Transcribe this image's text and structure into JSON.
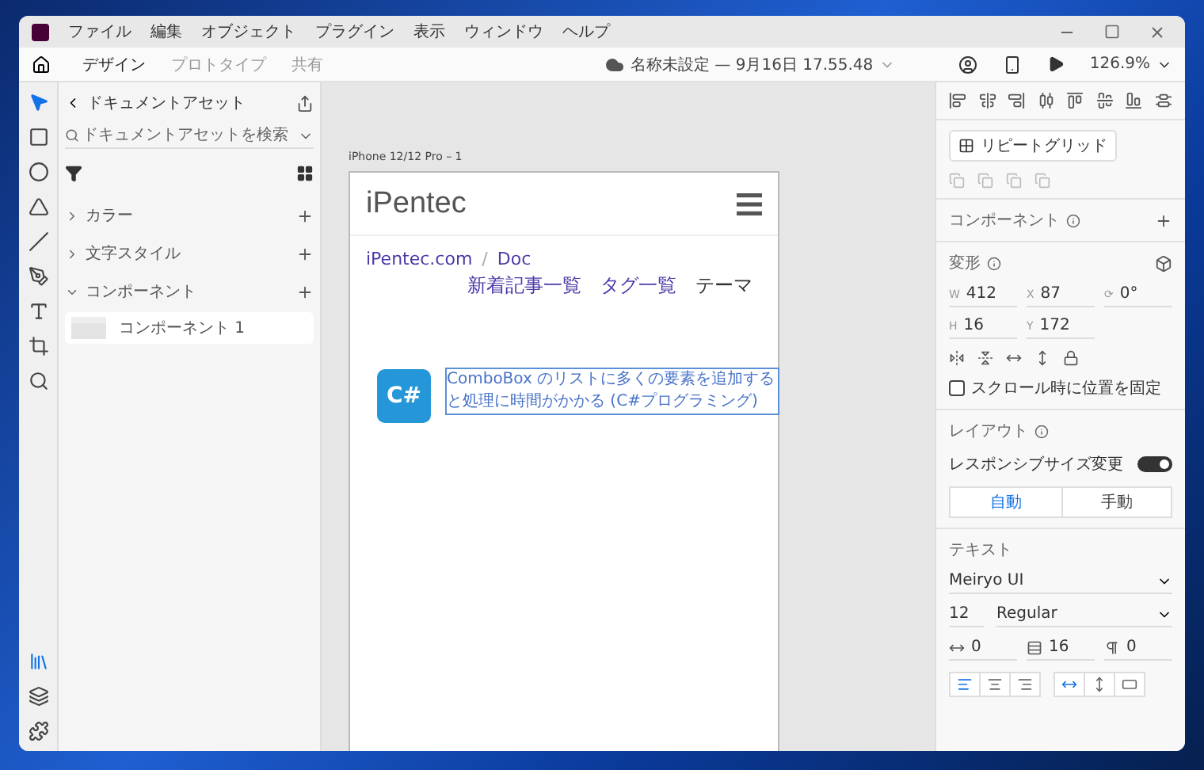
{
  "menu": [
    "ファイル",
    "編集",
    "オブジェクト",
    "プラグイン",
    "表示",
    "ウィンドウ",
    "ヘルプ"
  ],
  "tabs": [
    {
      "label": "デザイン",
      "selected": true
    },
    {
      "label": "プロトタイプ",
      "selected": false
    },
    {
      "label": "共有",
      "selected": false
    }
  ],
  "document_title": "名称未設定 — 9月16日 17.55.48",
  "zoom": "126.9%",
  "tools": [
    {
      "kind": "select",
      "selected": true
    },
    {
      "kind": "rectangle",
      "selected": false
    },
    {
      "kind": "ellipse",
      "selected": false
    },
    {
      "kind": "polygon",
      "selected": false
    },
    {
      "kind": "line",
      "selected": false
    },
    {
      "kind": "pen",
      "selected": false
    },
    {
      "kind": "text",
      "selected": false
    },
    {
      "kind": "artboard",
      "selected": false
    },
    {
      "kind": "zoom",
      "selected": false
    }
  ],
  "bottom_tools": [
    {
      "kind": "assets",
      "selected": true
    },
    {
      "kind": "layers",
      "selected": false
    },
    {
      "kind": "plugins",
      "selected": false
    }
  ],
  "assets": {
    "title": "ドキュメントアセット",
    "search": {
      "placeholder": "ドキュメントアセットを検索"
    },
    "sections": [
      {
        "label": "カラー",
        "expanded": false
      },
      {
        "label": "文字スタイル",
        "expanded": false
      },
      {
        "label": "コンポーネント",
        "expanded": true
      }
    ],
    "components": [
      {
        "label": "コンポーネント 1"
      }
    ]
  },
  "artboard": {
    "label": "iPhone 12/12 Pro – 1",
    "logo": "iPentec",
    "breadcrumb": [
      "iPentec.com",
      "Doc"
    ],
    "breadcrumb_separator": "/",
    "nav": [
      {
        "label": "新着記事一覧",
        "link": true
      },
      {
        "label": "タグ一覧",
        "link": true
      },
      {
        "label": "テーマ",
        "link": false
      }
    ],
    "badge": "C#",
    "article": {
      "title": "ComboBox のリストに多くの要素を追加すると処理に時間がかかる (C#プログラミング)",
      "selected": true
    }
  },
  "inspector": {
    "repeat_grid": "リピートグリッド",
    "component": "コンポーネント",
    "transform": "変形",
    "fields": [
      {
        "label": "W",
        "value": "412"
      },
      {
        "label": "X",
        "value": "87"
      },
      {
        "label": "⟳",
        "value": "0°"
      },
      {
        "label": "H",
        "value": "16"
      },
      {
        "label": "Y",
        "value": "172"
      }
    ],
    "fix_scroll": {
      "label": "スクロール時に位置を固定",
      "checked": false
    },
    "layout": "レイアウト",
    "responsive": {
      "label": "レスポンシブサイズ変更",
      "on": true
    },
    "resize_modes": [
      {
        "label": "自動",
        "selected": true
      },
      {
        "label": "手動",
        "selected": false
      }
    ],
    "text": "テキスト",
    "font": "Meiryo UI",
    "size": "12",
    "weight": "Regular",
    "spacing": [
      {
        "kind": "letter",
        "value": "0"
      },
      {
        "kind": "line",
        "value": "16"
      },
      {
        "kind": "paragraph",
        "value": "0"
      }
    ],
    "align": [
      {
        "kind": "left",
        "selected": true
      },
      {
        "kind": "center",
        "selected": false
      },
      {
        "kind": "right",
        "selected": false
      }
    ],
    "box": [
      {
        "kind": "auto-width",
        "selected": true
      },
      {
        "kind": "auto-height",
        "selected": false
      },
      {
        "kind": "fixed",
        "selected": false
      }
    ]
  }
}
